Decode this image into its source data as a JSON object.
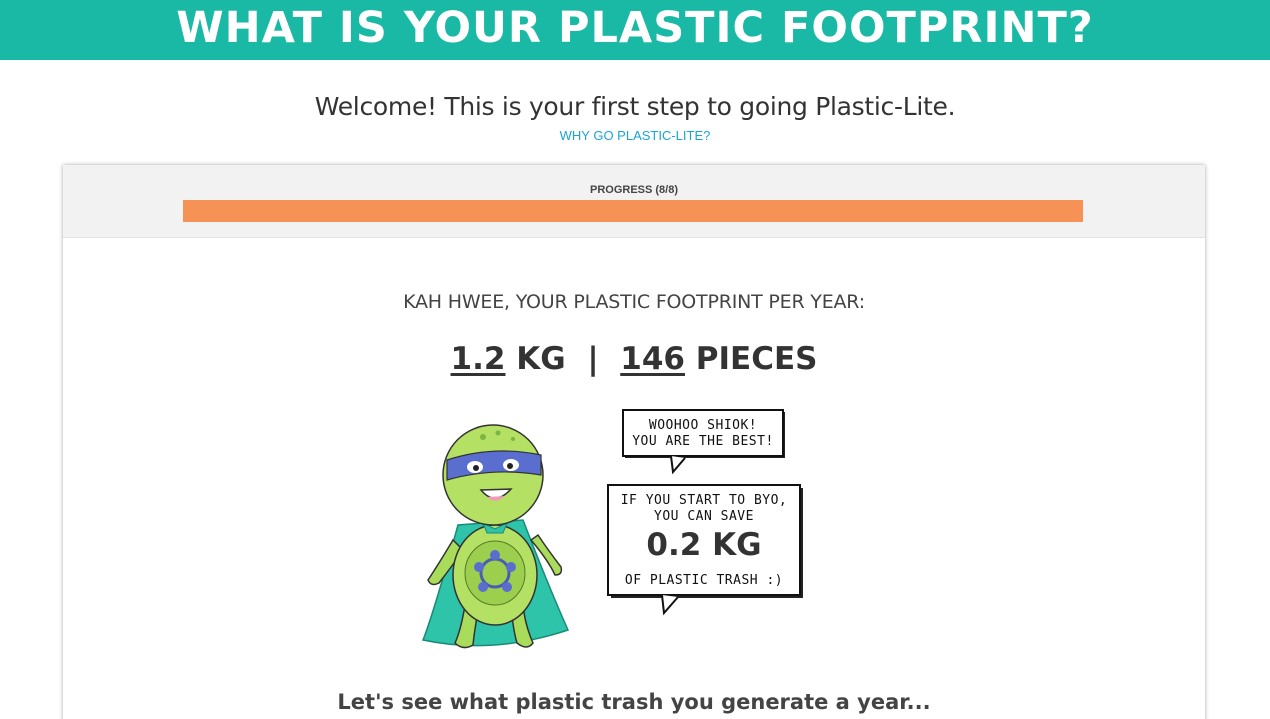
{
  "header": {
    "title": "WHAT IS YOUR PLASTIC FOOTPRINT?"
  },
  "intro": {
    "welcome": "Welcome! This is your first step to going Plastic-Lite.",
    "why_link": "WHY GO PLASTIC-LITE?"
  },
  "progress": {
    "label": "PROGRESS (8/8)",
    "current": 8,
    "total": 8,
    "fraction": 1.0,
    "fill_color": "#f79257"
  },
  "result": {
    "title": "KAH HWEE, YOUR PLASTIC FOOTPRINT PER YEAR:",
    "kg_value": "1.2",
    "kg_unit": "KG",
    "separator": "|",
    "pieces_value": "146",
    "pieces_unit": "PIECES"
  },
  "speech": {
    "bubble1_line1": "WOOHOO SHIOK!",
    "bubble1_line2": "YOU ARE THE BEST!",
    "bubble2_line1": "IF YOU START TO BYO,",
    "bubble2_line2": "YOU CAN SAVE",
    "save_amount": "0.2 KG",
    "bubble2_line3": "OF PLASTIC TRASH :)"
  },
  "mascot": {
    "icon": "superhero-turtle-icon"
  },
  "footer": {
    "text": "Let's see what plastic trash you generate a year..."
  },
  "colors": {
    "brand": "#1ab9a6",
    "link": "#1aa5d8",
    "progress": "#f79257"
  }
}
